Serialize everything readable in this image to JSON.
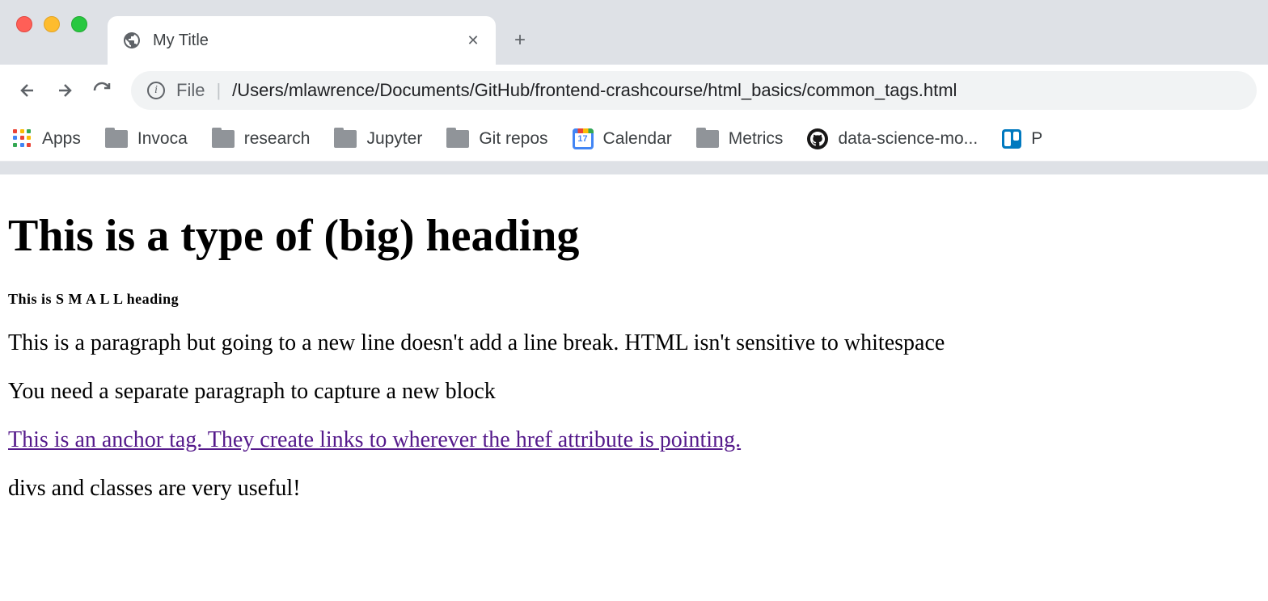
{
  "browser": {
    "tab": {
      "title": "My Title"
    },
    "url": {
      "prefix": "File",
      "path": "/Users/mlawrence/Documents/GitHub/frontend-crashcourse/html_basics/common_tags.html"
    },
    "bookmarks": [
      {
        "label": "Apps",
        "icon": "apps"
      },
      {
        "label": "Invoca",
        "icon": "folder"
      },
      {
        "label": "research",
        "icon": "folder"
      },
      {
        "label": "Jupyter",
        "icon": "folder"
      },
      {
        "label": "Git repos",
        "icon": "folder"
      },
      {
        "label": "Calendar",
        "icon": "calendar",
        "day": "17"
      },
      {
        "label": "Metrics",
        "icon": "folder"
      },
      {
        "label": "data-science-mo...",
        "icon": "github"
      },
      {
        "label": "P",
        "icon": "trello"
      }
    ]
  },
  "content": {
    "h1": "This is a type of (big) heading",
    "h6": "This is S M A L L heading",
    "p1": "This is a paragraph but going to a new line doesn't add a line break. HTML isn't sensitive to whitespace",
    "p2": "You need a separate paragraph to capture a new block",
    "anchor": "This is an anchor tag. They create links to wherever the href attribute is pointing.",
    "div": "divs and classes are very useful!"
  }
}
